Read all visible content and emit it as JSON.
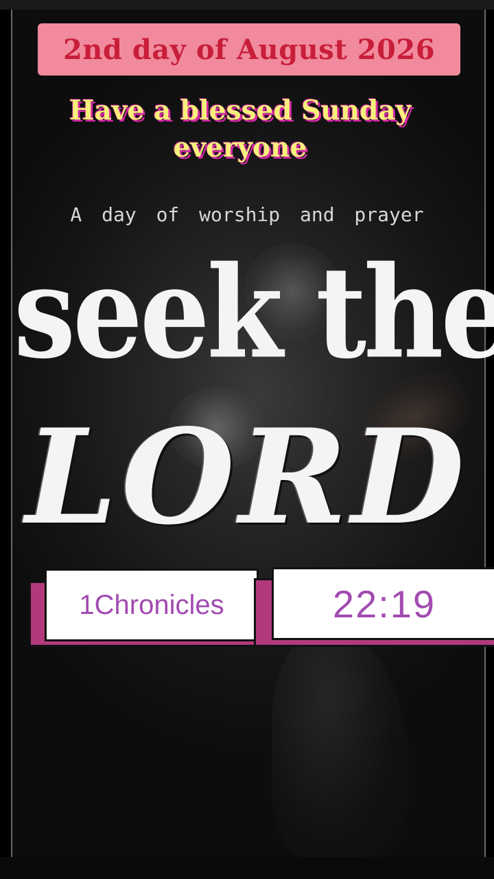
{
  "banner": {
    "date": "2nd day of August 2026"
  },
  "greeting": {
    "line1": "Have a blessed Sunday",
    "line2": "everyone"
  },
  "subtitle": "A day of worship and prayer",
  "headline": {
    "line1": "seek the",
    "line2": "LORD"
  },
  "verse": {
    "book": "1Chronicles",
    "reference": "22:19"
  },
  "colors": {
    "banner_bg": "#f08a9c",
    "banner_text": "#c81e3a",
    "greeting_text": "#f6f07a",
    "greeting_outline": "#d42aa5",
    "verse_text": "#a24bb1",
    "verse_shadow": "#b23a7c"
  }
}
